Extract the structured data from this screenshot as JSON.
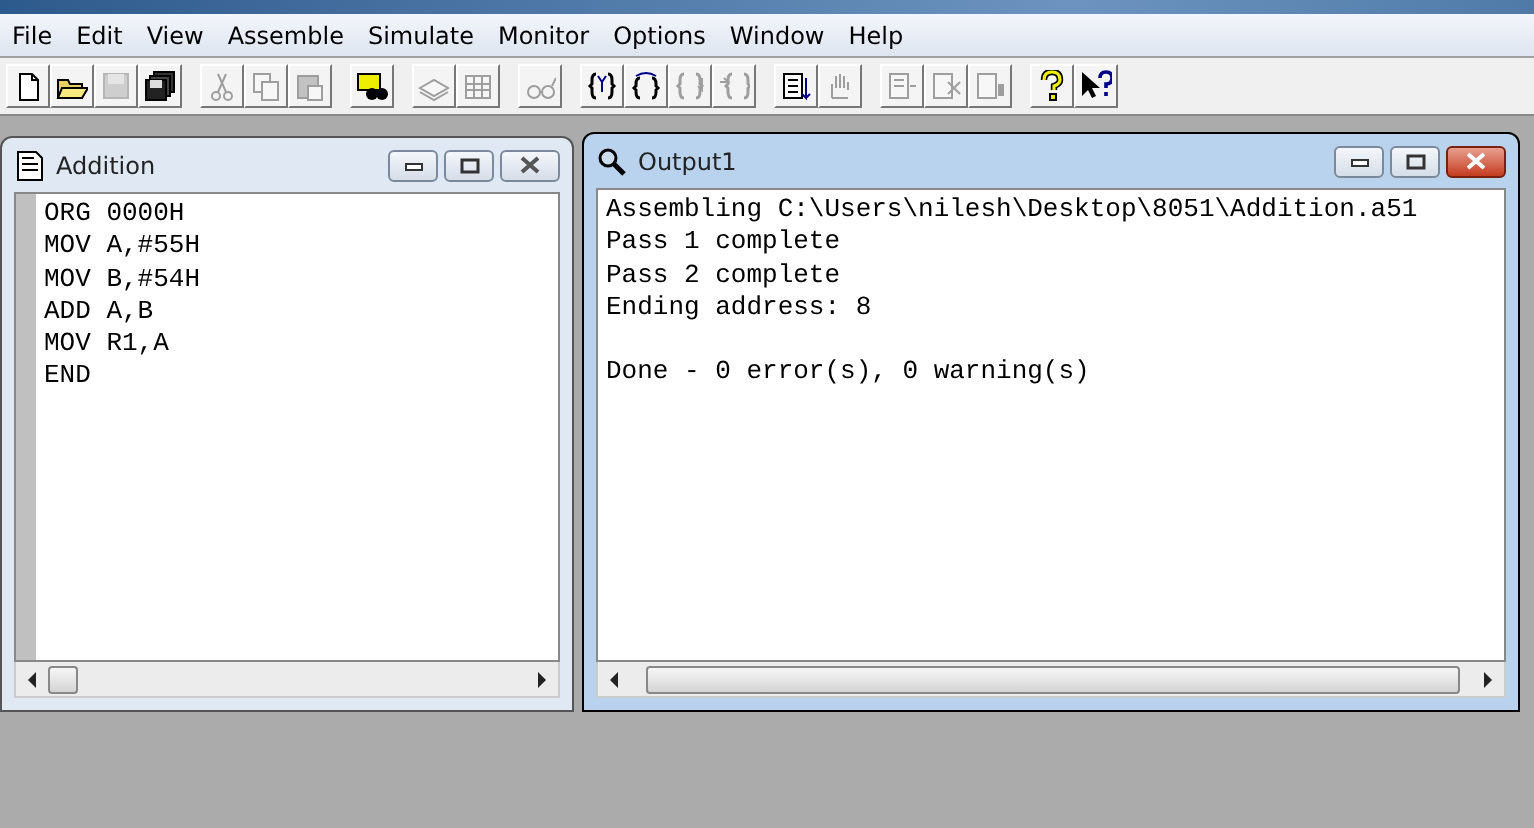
{
  "menu": [
    "File",
    "Edit",
    "View",
    "Assemble",
    "Simulate",
    "Monitor",
    "Options",
    "Window",
    "Help"
  ],
  "toolbar": [
    [
      {
        "kind": "new",
        "disabled": false
      },
      {
        "kind": "open",
        "disabled": false
      },
      {
        "kind": "save",
        "disabled": true
      },
      {
        "kind": "saveall",
        "disabled": false
      }
    ],
    [
      {
        "kind": "cut",
        "disabled": true
      },
      {
        "kind": "copy",
        "disabled": true
      },
      {
        "kind": "paste",
        "disabled": true
      }
    ],
    [
      {
        "kind": "find",
        "disabled": false
      }
    ],
    [
      {
        "kind": "stack",
        "disabled": true
      },
      {
        "kind": "grid",
        "disabled": true
      }
    ],
    [
      {
        "kind": "glasses",
        "disabled": true
      }
    ],
    [
      {
        "kind": "braces",
        "disabled": false
      },
      {
        "kind": "bracesover",
        "disabled": false
      },
      {
        "kind": "bracesdown",
        "disabled": true
      },
      {
        "kind": "bracesout",
        "disabled": true
      }
    ],
    [
      {
        "kind": "listdown",
        "disabled": false
      },
      {
        "kind": "hand",
        "disabled": true
      }
    ],
    [
      {
        "kind": "docright",
        "disabled": true
      },
      {
        "kind": "docx",
        "disabled": true
      },
      {
        "kind": "docbar",
        "disabled": true
      }
    ],
    [
      {
        "kind": "help",
        "disabled": false
      },
      {
        "kind": "pointerhelp",
        "disabled": false
      }
    ]
  ],
  "windows": [
    {
      "title": "Addition",
      "kind": "source",
      "active": false,
      "lines": [
        "ORG 0000H",
        "MOV A,#55H",
        "MOV B,#54H",
        "ADD A,B",
        "MOV R1,A",
        "END"
      ]
    },
    {
      "title": "Output1",
      "kind": "output",
      "active": true,
      "lines": [
        "Assembling C:\\Users\\nilesh\\Desktop\\8051\\Addition.a51",
        "Pass 1 complete",
        "Pass 2 complete",
        "Ending address: 8"
      ],
      "summary": "Done - 0 error(s), 0 warning(s)"
    }
  ]
}
